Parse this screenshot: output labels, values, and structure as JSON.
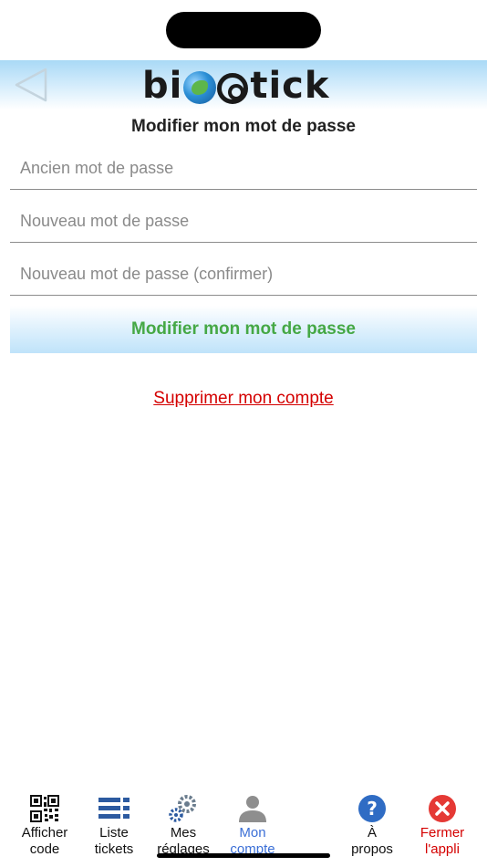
{
  "header": {
    "logo_text": "bioetick"
  },
  "page": {
    "title": "Modifier mon mot de passe"
  },
  "form": {
    "old_password_placeholder": "Ancien mot de passe",
    "new_password_placeholder": "Nouveau mot de passe",
    "confirm_password_placeholder": "Nouveau mot de passe (confirmer)",
    "submit_label": "Modifier mon mot de passe"
  },
  "delete_account_label": "Supprimer mon compte",
  "tabs": [
    {
      "label": "Afficher\ncode",
      "icon": "qr-code-icon"
    },
    {
      "label": "Liste\ntickets",
      "icon": "list-icon"
    },
    {
      "label": "Mes\nréglages",
      "icon": "gears-icon"
    },
    {
      "label": "Mon\ncompte",
      "icon": "user-icon",
      "active": true
    },
    {
      "label": "À\npropos",
      "icon": "help-icon"
    },
    {
      "label": "Fermer\nl'appli",
      "icon": "close-icon"
    }
  ],
  "colors": {
    "accent_green": "#45a845",
    "danger_red": "#d40000",
    "active_tab_blue": "#3b6fd6",
    "header_blue": "#a9d9f6"
  }
}
